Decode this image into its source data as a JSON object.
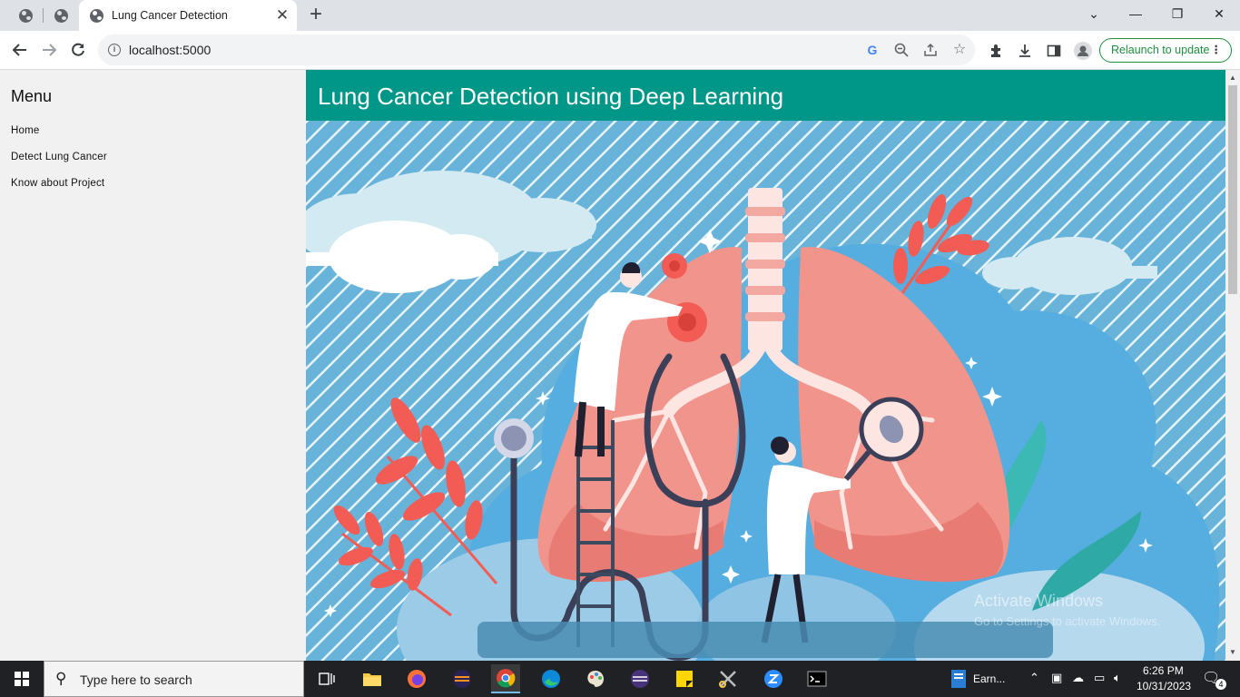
{
  "browser": {
    "tab_title": "Lung Cancer Detection",
    "tab_close": "✕",
    "new_tab": "+",
    "url": "localhost:5000",
    "relaunch_label": "Relaunch to update",
    "relaunch_menu": "⋮",
    "window_controls": {
      "minimize": "—",
      "restore": "❐",
      "close": "✕",
      "tab_list": "⌄"
    }
  },
  "sidebar": {
    "title": "Menu",
    "items": [
      {
        "label": "Home"
      },
      {
        "label": "Detect Lung Cancer"
      },
      {
        "label": "Know about Project"
      }
    ]
  },
  "main": {
    "title": "Lung Cancer Detection using Deep Learning",
    "hero_icon": "lungs-doctors-illustration"
  },
  "watermark": {
    "line1": "Activate Windows",
    "line2": "Go to Settings to activate Windows."
  },
  "taskbar": {
    "search_placeholder": "Type here to search",
    "pinned_app_label": "Earn...",
    "time": "6:26 PM",
    "date": "10/31/2023",
    "notification_count": "4"
  },
  "colors": {
    "header_teal": "#009688",
    "sky_blue": "#6bb7db",
    "lung_pink": "#f08c84",
    "accent_green": "#1e8e3e"
  }
}
